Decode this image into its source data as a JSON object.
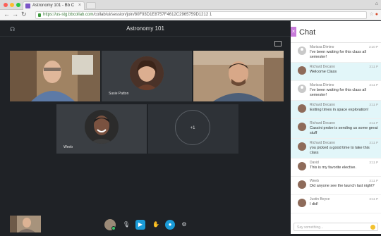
{
  "browser": {
    "tab_title": "Astronomy 101 - Bb C",
    "url_secure": "https://us-stg.bbcollab.com",
    "url_path": "/collab/ui/session/join/80F93D1E8757F4612C2965759D1212 1"
  },
  "header": {
    "title": "Astronomy 101"
  },
  "participants": [
    {
      "name": ""
    },
    {
      "name": "Susie Patton"
    },
    {
      "name": ""
    },
    {
      "name": "Weeb"
    }
  ],
  "overflow": {
    "label": "+1"
  },
  "chat": {
    "title": "Chat",
    "input_placeholder": "Say something...",
    "messages": [
      {
        "author": "Marissa Dimino",
        "time": "3:10 P",
        "text": "I've been waiting for this class all semester!",
        "highlight": false,
        "avatar": "generic"
      },
      {
        "author": "Richard Decano",
        "time": "3:11 P",
        "text": "Welcome Class",
        "highlight": true,
        "avatar": "photo"
      },
      {
        "author": "Marissa Dimino",
        "time": "3:11 P",
        "text": "I've been waiting for this class all semester!",
        "highlight": false,
        "avatar": "generic"
      },
      {
        "author": "Richard Decano",
        "time": "3:11 P",
        "text": "Exiting times in space exploration!",
        "highlight": true,
        "avatar": "photo"
      },
      {
        "author": "Richard Decano",
        "time": "3:11 P",
        "text": "Cassini probe is sending us some great stuff",
        "highlight": true,
        "avatar": "photo"
      },
      {
        "author": "Richard Decano",
        "time": "3:11 P",
        "text": "you picked a good time to take this class",
        "highlight": true,
        "avatar": "photo"
      },
      {
        "author": "David",
        "time": "3:11 P",
        "text": "This is my favorite elective.",
        "highlight": false,
        "avatar": "photo"
      },
      {
        "author": "Weeb",
        "time": "3:11 P",
        "text": "Did anyone see the launch last night?",
        "highlight": false,
        "avatar": "photo"
      },
      {
        "author": "Justin Boyce",
        "time": "3:11 P",
        "text": "I did!",
        "highlight": false,
        "avatar": "photo"
      }
    ]
  }
}
